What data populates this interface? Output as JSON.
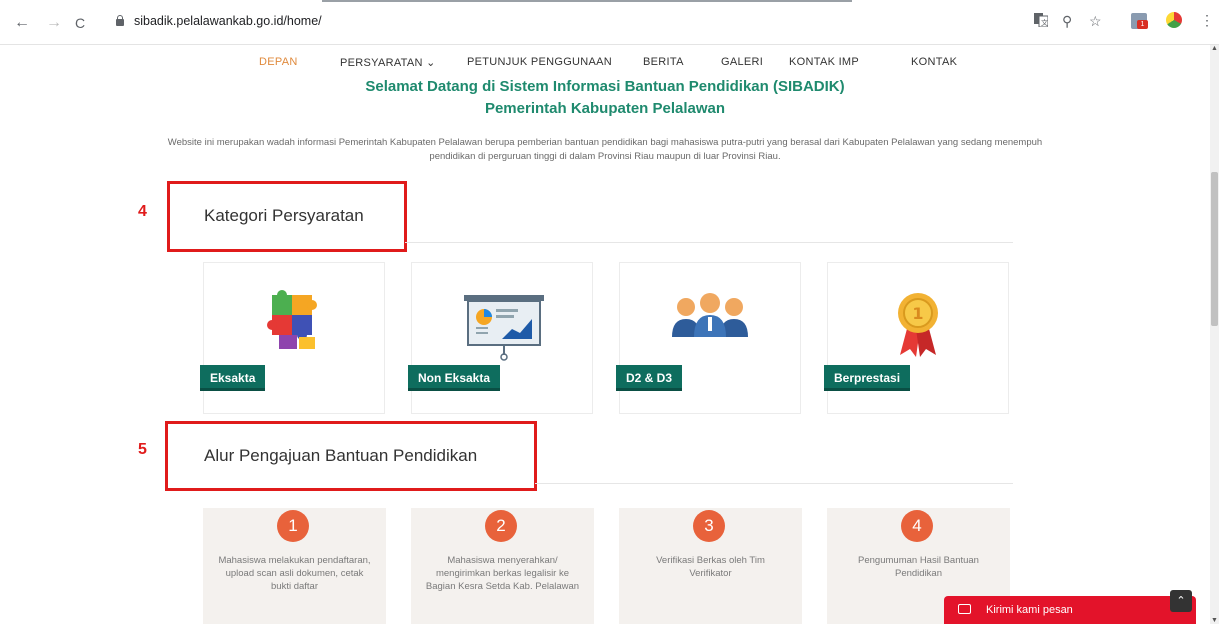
{
  "browser": {
    "url": "sibadik.pelalawankab.go.id/home/",
    "back": "←",
    "forward": "→",
    "reload": "C",
    "translate_icon": "translate-icon",
    "zoom_icon": "⚲",
    "star_icon": "☆",
    "menu": "⋮"
  },
  "nav": {
    "items": [
      "DEPAN",
      "PERSYARATAN ⌄",
      "PETUNJUK PENGGUNAAN",
      "BERITA",
      "GALERI",
      "KONTAK IMP",
      "KONTAK"
    ],
    "active_color": "#e08a3c"
  },
  "hero": {
    "line1": "Selamat Datang di Sistem Informasi Bantuan Pendidikan (SIBADIK)",
    "line2": "Pemerintah Kabupaten Pelalawan",
    "intro": "Website ini merupakan wadah informasi Pemerintah Kabupaten Pelalawan berupa pemberian bantuan pendidikan bagi mahasiswa putra-putri yang berasal dari Kabupaten Pelalawan yang sedang menempuh pendidikan di perguruan tinggi di dalam Provinsi Riau maupun di luar Provinsi Riau."
  },
  "annotations": {
    "first": "4",
    "second": "5",
    "color": "#e01b1b"
  },
  "kategori": {
    "title": "Kategori Persyaratan",
    "cards": [
      {
        "label": "Eksakta",
        "icon": "puzzle-icon"
      },
      {
        "label": "Non Eksakta",
        "icon": "presentation-board-icon"
      },
      {
        "label": "D2 & D3",
        "icon": "people-group-icon"
      },
      {
        "label": "Berprestasi",
        "icon": "award-medal-icon"
      }
    ]
  },
  "alur": {
    "title": "Alur Pengajuan Bantuan Pendidikan",
    "steps": [
      {
        "num": "1",
        "text": "Mahasiswa melakukan pendaftaran, upload scan asli dokumen, cetak bukti daftar"
      },
      {
        "num": "2",
        "text": "Mahasiswa menyerahkan/ mengirimkan berkas legalisir ke Bagian Kesra Setda Kab. Pelalawan"
      },
      {
        "num": "3",
        "text": "Verifikasi Berkas oleh Tim Verifikator"
      },
      {
        "num": "4",
        "text": "Pengumuman Hasil Bantuan Pendidikan"
      }
    ]
  },
  "chat": {
    "label": "Kirimi kami pesan"
  },
  "colors": {
    "brand_green": "#0e6d5e",
    "heading_green": "#1f8a6e",
    "step_orange": "#e8623b",
    "chat_red": "#e3132a"
  }
}
